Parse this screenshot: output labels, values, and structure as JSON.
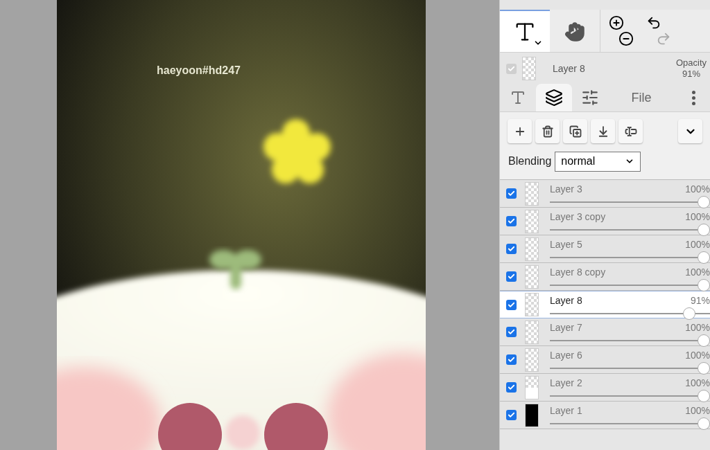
{
  "canvas": {
    "caption": "haeyoon#hd247"
  },
  "toolbar": {
    "tools": [
      {
        "kind": "text",
        "selected": true
      },
      {
        "kind": "hand",
        "selected": false
      }
    ]
  },
  "current_layer": {
    "visible": true,
    "name": "Layer 8",
    "opacity_label": "Opacity",
    "opacity": "91%"
  },
  "tabs": [
    {
      "kind": "text",
      "selected": false
    },
    {
      "kind": "layers",
      "selected": true
    },
    {
      "kind": "adjust",
      "selected": false
    },
    {
      "kind": "label",
      "label": "File",
      "selected": false
    },
    {
      "kind": "more",
      "selected": false
    }
  ],
  "blending": {
    "label": "Blending",
    "value": "normal"
  },
  "layers": [
    {
      "name": "Layer 3",
      "opacity": "100%",
      "level": 1,
      "visible": true,
      "selected": false,
      "kind": "checker"
    },
    {
      "name": "Layer 3 copy",
      "opacity": "100%",
      "level": 1,
      "visible": true,
      "selected": false,
      "kind": "checker"
    },
    {
      "name": "Layer 5",
      "opacity": "100%",
      "level": 1,
      "visible": true,
      "selected": false,
      "kind": "checker"
    },
    {
      "name": "Layer 8 copy",
      "opacity": "100%",
      "level": 1,
      "visible": true,
      "selected": false,
      "kind": "checker"
    },
    {
      "name": "Layer 8",
      "opacity": "91%",
      "level": 0.91,
      "visible": true,
      "selected": true,
      "kind": "checker"
    },
    {
      "name": "Layer 7",
      "opacity": "100%",
      "level": 1,
      "visible": true,
      "selected": false,
      "kind": "checker"
    },
    {
      "name": "Layer 6",
      "opacity": "100%",
      "level": 1,
      "visible": true,
      "selected": false,
      "kind": "checker"
    },
    {
      "name": "Layer 2",
      "opacity": "100%",
      "level": 1,
      "visible": true,
      "selected": false,
      "kind": "white"
    },
    {
      "name": "Layer 1",
      "opacity": "100%",
      "level": 1,
      "visible": true,
      "selected": false,
      "kind": "black"
    }
  ]
}
